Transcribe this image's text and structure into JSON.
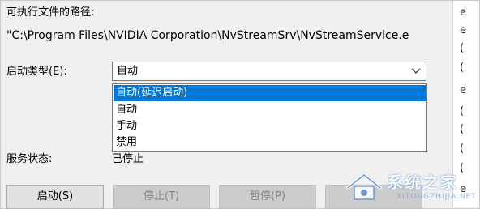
{
  "executable": {
    "label": "可执行文件的路径:",
    "path": "\"C:\\Program Files\\NVIDIA Corporation\\NvStreamSrv\\NvStreamService.e"
  },
  "startup_type": {
    "label": "启动类型(E):",
    "selected_value": "自动",
    "options": [
      {
        "label": "自动(延迟启动)",
        "highlighted": true
      },
      {
        "label": "自动",
        "highlighted": false
      },
      {
        "label": "手动",
        "highlighted": false
      },
      {
        "label": "禁用",
        "highlighted": false
      }
    ]
  },
  "service_status": {
    "label": "服务状态:",
    "value": "已停止"
  },
  "buttons": {
    "start": "启动(S)",
    "stop": "停止(T)",
    "pause": "暂停(P)"
  },
  "right_strip_fragments": [
    "e",
    "e",
    "(",
    "(",
    "e",
    "(",
    "(",
    "(",
    "(",
    "e"
  ],
  "watermark": {
    "text": "系统之家",
    "sub": "XITONGZHIJIA.NET"
  },
  "colors": {
    "highlight": "#0078d7",
    "panel": "#f0f0f0",
    "disabled_text": "#838383"
  },
  "icons": {
    "combo_arrow": "chevron-down-icon",
    "watermark_logo": "house-logo-icon"
  }
}
